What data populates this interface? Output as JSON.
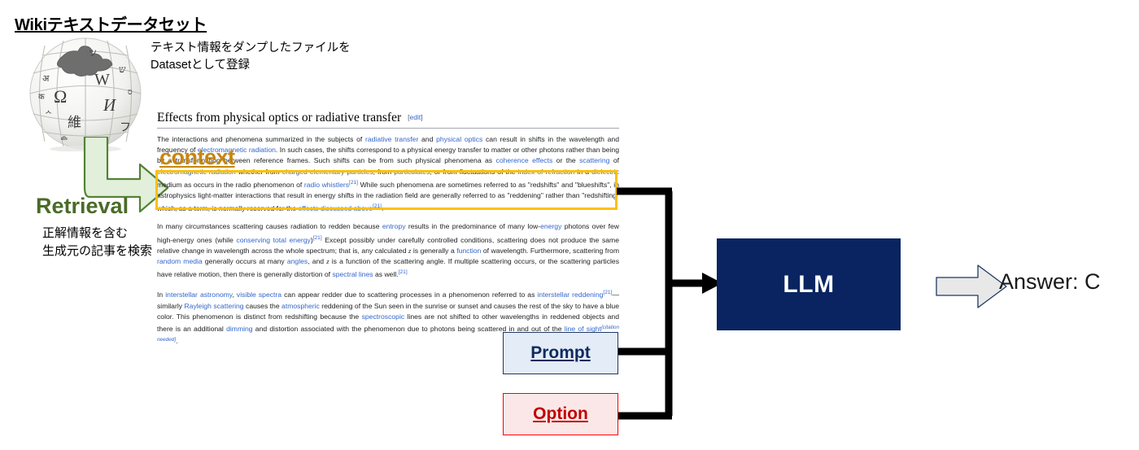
{
  "title": "Wikiテキストデータセット",
  "dataset": {
    "caption": "テキスト情報をダンプしたファイルを\nDatasetとして登録"
  },
  "retrieval": {
    "label": "Retrieval",
    "description": "正解情報を含む\n生成元の記事を検索",
    "arrow_icon": "curved-arrow-icon",
    "fill_color": "#e2efda",
    "stroke_color": "#548235"
  },
  "context": {
    "word": "context",
    "color": "#c8860d",
    "highlight_border_color": "#ffc000"
  },
  "wiki": {
    "heading": "Effects from physical optics or radiative transfer",
    "edit_label": "edit",
    "edit_bracket_open": "[",
    "edit_bracket_close": "]",
    "paragraph1": {
      "seg1": "The interactions and phenomena summarized in the subjects of ",
      "link1": "radiative transfer",
      "seg2": " and ",
      "link2": "physical optics",
      "seg3": " can result in shifts in the wavelength and frequency of ",
      "link3": "electromagnetic radiation",
      "seg4": ". In such cases, the shifts correspond to a physical energy transfer to matter or other photons rather than being by a transformation between reference frames. Such shifts can be from such physical phenomena as ",
      "link4": "coherence effects",
      "seg5": " or the ",
      "link5": "scattering",
      "seg6": " of ",
      "link6": "electromagnetic radiation",
      "seg7": " whether from ",
      "link7": "charged elementary particles",
      "seg8": ", from ",
      "link8": "particulates",
      "seg9": ", or from fluctuations of the ",
      "link9": "index of refraction",
      "seg10": " in a ",
      "link10": "dielectric",
      "seg11": " medium as occurs in the radio phenomenon of ",
      "link11": "radio whistlers",
      "ref1": "[21]",
      "seg12": " While such phenomena are sometimes referred to as \"redshifts\" and \"blueshifts\", in astrophysics light-matter interactions that result in energy shifts in the radiation field are generally referred to as \"reddening\" rather than \"redshifting\" which, as a term, is normally reserved for the ",
      "link12": "effects discussed above",
      "ref2": "[21]",
      "seg13": "."
    },
    "paragraph2": {
      "seg1": "In many circumstances scattering causes radiation to redden because ",
      "link1": "entropy",
      "seg2": " results in the predominance of many low-",
      "link2": "energy",
      "seg3": " photons over few high-energy ones (while ",
      "link3": "conserving total energy",
      "seg4": ")",
      "ref1": "[21]",
      "seg5": " Except possibly under carefully controlled conditions, scattering does not produce the same relative change in wavelength across the whole spectrum; that is, any calculated ",
      "math1": "z",
      "seg6": " is generally a ",
      "link4": "function",
      "seg7": " of wavelength. Furthermore, scattering from ",
      "link5": "random media",
      "seg8": " generally occurs at many ",
      "link6": "angles",
      "seg9": ", and ",
      "math2": "z",
      "seg10": " is a function of the scattering angle. If multiple scattering occurs, or the scattering particles have relative motion, then there is generally distortion of ",
      "link7": "spectral lines",
      "seg11": " as well.",
      "ref2": "[21]"
    },
    "paragraph3": {
      "seg1": "In ",
      "link1": "interstellar astronomy",
      "seg2": ", ",
      "link2": "visible spectra",
      "seg3": " can appear redder due to scattering processes in a phenomenon referred to as ",
      "link3": "interstellar reddening",
      "ref1": "[21]",
      "seg4": "—similarly ",
      "link4": "Rayleigh scattering",
      "seg5": " causes the ",
      "link5": "atmospheric",
      "seg6": " reddening of the Sun seen in the sunrise or sunset and causes the rest of the sky to have a blue color. This phenomenon is distinct from redshifting because the ",
      "link6": "spectroscopic",
      "seg7": " lines are not shifted to other wavelengths in reddened objects and there is an additional ",
      "link7": "dimming",
      "seg8": " and distortion associated with the phenomenon due to photons being scattered in and out of the ",
      "link8": "line of sight",
      "ref2": "[citation needed]",
      "seg9": "."
    }
  },
  "prompt": {
    "label": "Prompt",
    "fill_color": "#e3ecf7",
    "border_color": "#1f3864",
    "text_color": "#0f2a5e"
  },
  "option": {
    "label": "Option",
    "fill_color": "#fbe7e7",
    "border_color": "#ff0000",
    "text_color": "#c00000"
  },
  "llm": {
    "label": "LLM",
    "fill_color": "#0a2461",
    "text_color": "#ffffff"
  },
  "output": {
    "arrow_icon": "block-arrow-right-icon",
    "answer": "Answer: C"
  },
  "globe": {
    "icon": "wikipedia-globe-icon",
    "glyphs": [
      "Ω",
      "W",
      "И",
      "維",
      "フ",
      "ש",
      "अ"
    ]
  }
}
